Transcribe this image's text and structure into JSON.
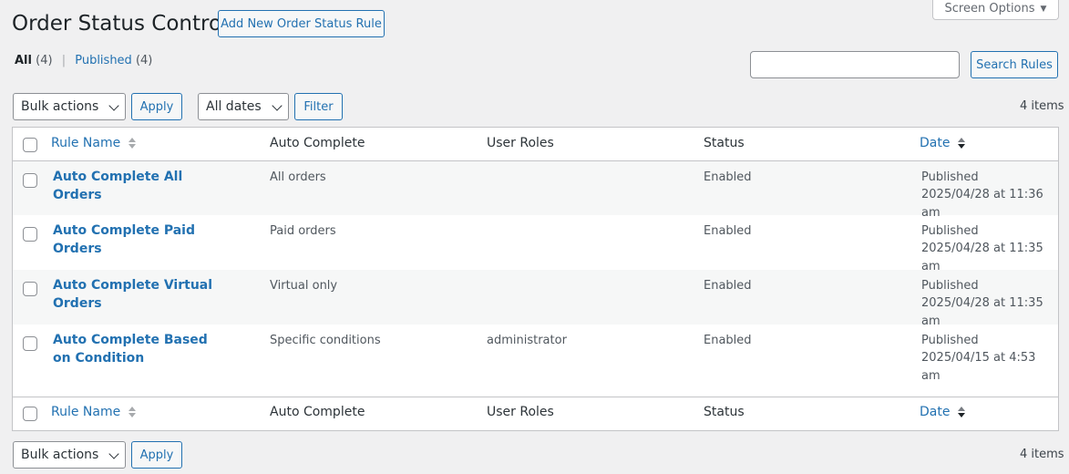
{
  "header": {
    "title": "Order Status Control",
    "add_new": "Add New Order Status Rule",
    "screen_options": "Screen Options"
  },
  "views": {
    "all_label": "All",
    "all_count": "(4)",
    "separator": "|",
    "published_label": "Published",
    "published_count": "(4)"
  },
  "search": {
    "button": "Search Rules",
    "value": ""
  },
  "tablenav_top": {
    "bulk_actions": "Bulk actions",
    "apply": "Apply",
    "dates": "All dates",
    "filter": "Filter",
    "items": "4 items"
  },
  "tablenav_bottom": {
    "bulk_actions": "Bulk actions",
    "apply": "Apply",
    "items": "4 items"
  },
  "columns": {
    "rule_name": "Rule Name",
    "auto_complete": "Auto Complete",
    "user_roles": "User Roles",
    "status": "Status",
    "date": "Date"
  },
  "rows": [
    {
      "name": "Auto Complete All Orders",
      "auto_complete": "All orders",
      "user_roles": "",
      "status": "Enabled",
      "date_status": "Published",
      "date": "2025/04/28 at 11:36 am"
    },
    {
      "name": "Auto Complete Paid Orders",
      "auto_complete": "Paid orders",
      "user_roles": "",
      "status": "Enabled",
      "date_status": "Published",
      "date": "2025/04/28 at 11:35 am"
    },
    {
      "name": "Auto Complete Virtual Orders",
      "auto_complete": "Virtual only",
      "user_roles": "",
      "status": "Enabled",
      "date_status": "Published",
      "date": "2025/04/28 at 11:35 am"
    },
    {
      "name": "Auto Complete Based on Condition",
      "auto_complete": "Specific conditions",
      "user_roles": "administrator",
      "status": "Enabled",
      "date_status": "Published",
      "date": "2025/04/15 at 4:53 am"
    }
  ],
  "colors": {
    "link": "#2271b1",
    "background": "#f0f0f1",
    "border": "#c3c4c7"
  }
}
